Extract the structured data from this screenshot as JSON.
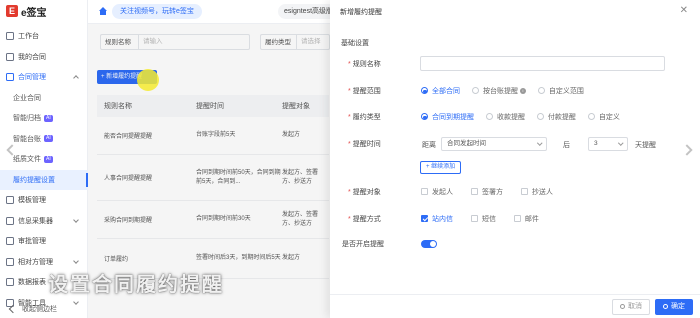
{
  "app": {
    "logo_letter": "E",
    "logo_text": "e签宝"
  },
  "sidebar": {
    "items": [
      {
        "label": "工作台",
        "icon": "workbench-icon"
      },
      {
        "label": "我的合同",
        "icon": "contract-icon"
      },
      {
        "label": "合同管理",
        "icon": "contract-manage-icon"
      },
      {
        "label": "企业合同"
      },
      {
        "label": "智能归档",
        "badge": "AI"
      },
      {
        "label": "智能台账",
        "badge": "AI"
      },
      {
        "label": "纸质文件",
        "badge": "AI"
      },
      {
        "label": "履约提醒设置"
      },
      {
        "label": "模板管理",
        "icon": "template-icon"
      },
      {
        "label": "信息采集器",
        "icon": "collector-icon"
      },
      {
        "label": "审批管理",
        "icon": "approval-icon"
      },
      {
        "label": "相对方管理",
        "icon": "counterparty-icon"
      },
      {
        "label": "数据报表",
        "icon": "report-icon"
      },
      {
        "label": "智能工具",
        "icon": "tools-icon"
      }
    ],
    "collapse_label": "收起侧边栏"
  },
  "topbar": {
    "promo": "关注视频号，玩转e签宝",
    "account": "esigntest高级版"
  },
  "main": {
    "filter": {
      "name_label": "规则名称",
      "name_placeholder": "请输入",
      "type_label": "履约类型",
      "type_placeholder": "请选择"
    },
    "new_button": "+ 新增履约提醒",
    "table": {
      "headers": [
        "规则名称",
        "提醒时间",
        "提醒对象"
      ],
      "rows": [
        {
          "name": "能否合同提醒提醒",
          "time": "台账字段前5天",
          "target": "发起方"
        },
        {
          "name": "人事合同提醒提醒",
          "time": "合同到期时间前50天，合同到期前5天，合同到...",
          "target": "发起方、签署方、抄送方"
        },
        {
          "name": "采购合同到期提醒",
          "time": "合同到期时间前30天",
          "target": "发起方、签署方、抄送方"
        },
        {
          "name": "订单履约",
          "time": "签署时间后3天，到期时间后5天",
          "target": "发起方"
        }
      ]
    }
  },
  "caption": "设置合同履约提醒",
  "drawer": {
    "title": "新增履约提醒",
    "close": "✕",
    "section": "基础设置",
    "fields": {
      "rule_name": {
        "label": "规则名称",
        "value": ""
      },
      "scope": {
        "label": "提醒范围",
        "options": [
          "全部合同",
          "按台账提醒",
          "自定义范围"
        ],
        "selected": 0
      },
      "type": {
        "label": "履约类型",
        "options": [
          "合同到期提醒",
          "收款提醒",
          "付款提醒",
          "自定义"
        ],
        "selected": 0
      },
      "time": {
        "label": "提醒时间",
        "distance": "距离",
        "base": "合同发起时间",
        "after": "后",
        "days": "3",
        "unit": "天提醒",
        "add": "+ 继续添加"
      },
      "target": {
        "label": "提醒对象",
        "options": [
          "发起人",
          "签署方",
          "抄送人"
        ],
        "checked": [
          false,
          false,
          false
        ]
      },
      "method": {
        "label": "提醒方式",
        "options": [
          "站内信",
          "短信",
          "邮件"
        ],
        "checked": [
          true,
          false,
          false
        ]
      },
      "enabled": {
        "label": "是否开启提醒",
        "value": true
      }
    },
    "footer": {
      "cancel": "取消",
      "ok": "确定"
    }
  },
  "colors": {
    "accent": "#2d6cf6",
    "logo": "#e23a2e"
  }
}
